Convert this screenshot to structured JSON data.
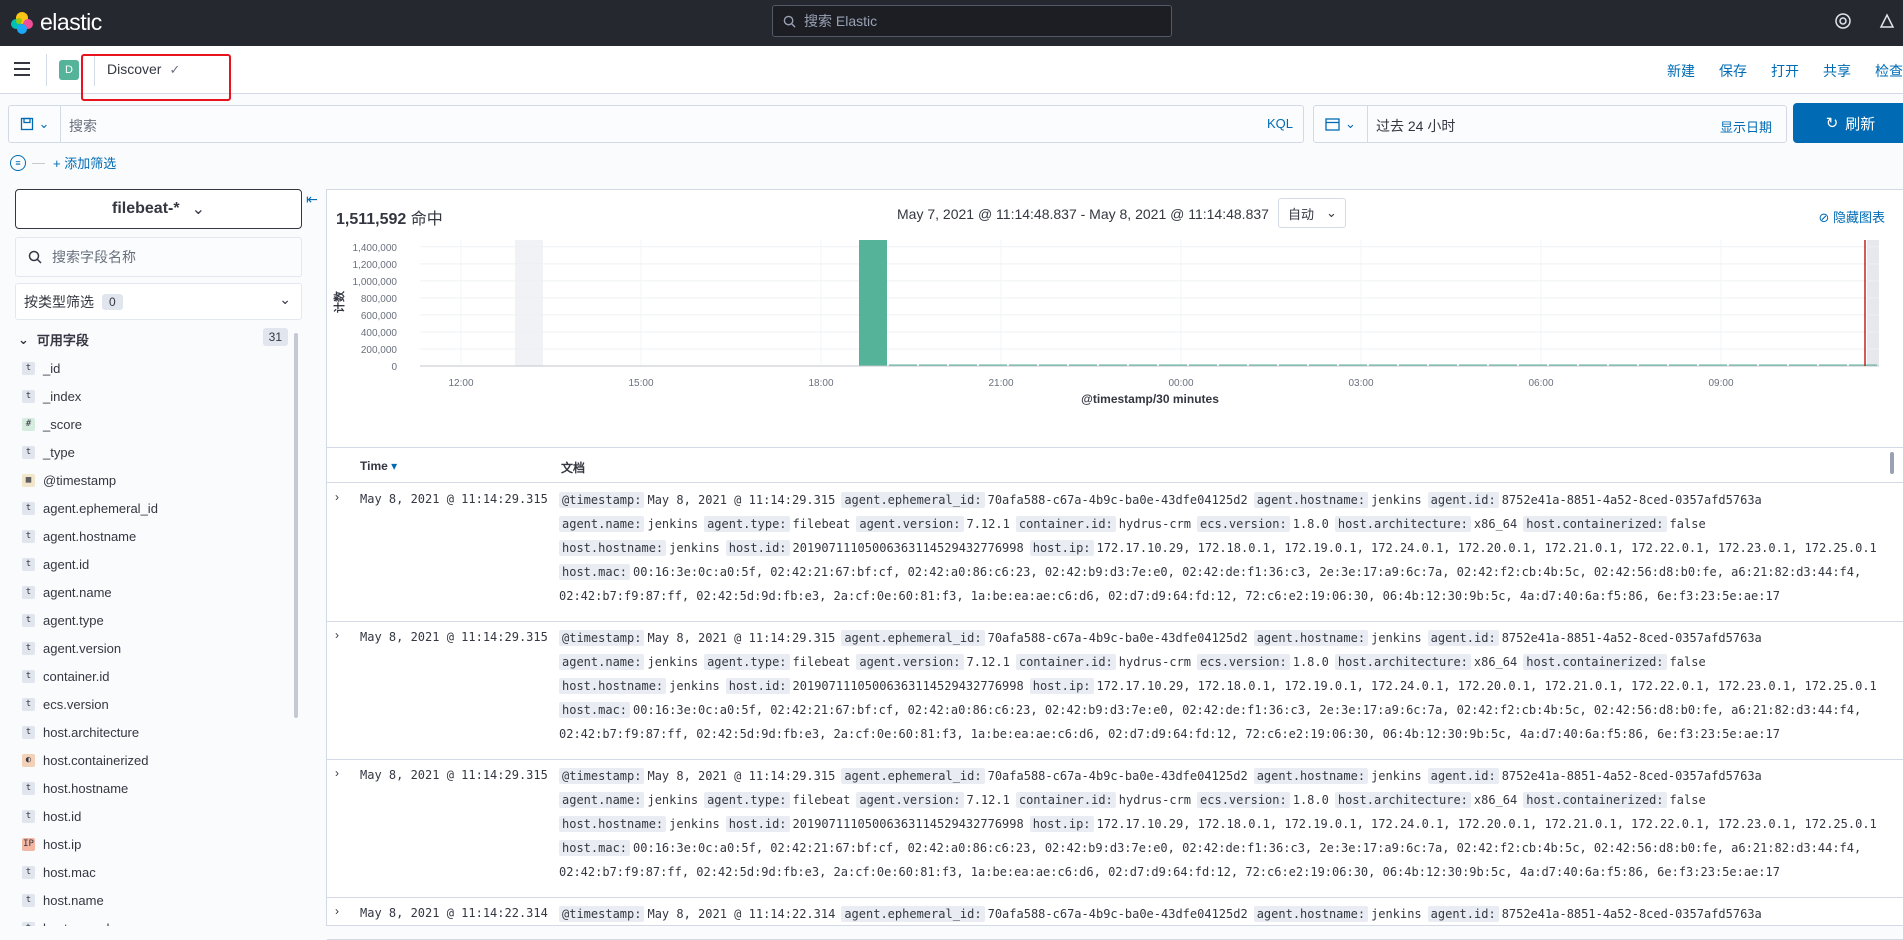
{
  "app": {
    "logo_text": "elastic",
    "global_search_placeholder": "搜索 Elastic"
  },
  "nav": {
    "space_initial": "D",
    "breadcrumb": "Discover",
    "actions": [
      "新建",
      "保存",
      "打开",
      "共享",
      "检查"
    ]
  },
  "query": {
    "placeholder": "搜索",
    "language": "KQL"
  },
  "time": {
    "range": "过去 24 小时",
    "show_dates": "显示日期",
    "refresh": "刷新"
  },
  "filters": {
    "add_filter": "+ 添加筛选"
  },
  "sidebar": {
    "index_pattern": "filebeat-*",
    "field_search_placeholder": "搜索字段名称",
    "type_filter_label": "按类型筛选",
    "type_filter_count": "0",
    "available_label": "可用字段",
    "available_count": "31",
    "fields": [
      {
        "type": "t",
        "name": "_id"
      },
      {
        "type": "t",
        "name": "_index"
      },
      {
        "type": "#",
        "name": "_score"
      },
      {
        "type": "t",
        "name": "_type"
      },
      {
        "type": "date",
        "name": "@timestamp"
      },
      {
        "type": "t",
        "name": "agent.ephemeral_id"
      },
      {
        "type": "t",
        "name": "agent.hostname"
      },
      {
        "type": "t",
        "name": "agent.id"
      },
      {
        "type": "t",
        "name": "agent.name"
      },
      {
        "type": "t",
        "name": "agent.type"
      },
      {
        "type": "t",
        "name": "agent.version"
      },
      {
        "type": "t",
        "name": "container.id"
      },
      {
        "type": "t",
        "name": "ecs.version"
      },
      {
        "type": "t",
        "name": "host.architecture"
      },
      {
        "type": "bool",
        "name": "host.containerized"
      },
      {
        "type": "t",
        "name": "host.hostname"
      },
      {
        "type": "t",
        "name": "host.id"
      },
      {
        "type": "ip",
        "name": "host.ip"
      },
      {
        "type": "t",
        "name": "host.mac"
      },
      {
        "type": "t",
        "name": "host.name"
      },
      {
        "type": "t",
        "name": "host.os.codename"
      }
    ]
  },
  "results": {
    "hits": "1,511,592",
    "hits_suffix": "命中",
    "date_range": "May 7, 2021 @ 11:14:48.837 - May 8, 2021 @ 11:14:48.837",
    "interval": "自动",
    "hide_chart": "隐藏图表",
    "col_time": "Time",
    "col_doc": "文档"
  },
  "chart_data": {
    "type": "bar",
    "ylabel": "计数",
    "xlabel": "@timestamp/30 minutes",
    "y_ticks": [
      "1,400,000",
      "1,200,000",
      "1,000,000",
      "800,000",
      "600,000",
      "400,000",
      "200,000",
      "0"
    ],
    "x_ticks": [
      "12:00",
      "15:00",
      "18:00",
      "21:00",
      "00:00",
      "03:00",
      "06:00",
      "09:00"
    ],
    "ylim": [
      0,
      1480000
    ],
    "series": [
      {
        "values": [
          1480000,
          5000,
          5000,
          5000,
          5000,
          5000,
          5000,
          5000,
          5000,
          5000,
          5000,
          5000,
          5000,
          5000,
          5000,
          5000,
          5000,
          5000,
          5000,
          5000,
          5000,
          5000,
          5000,
          5000,
          5000,
          5000,
          5000,
          5000,
          5000,
          5000,
          5000,
          5000,
          5000,
          5000
        ]
      }
    ],
    "colors": {
      "bar": "#54b399",
      "now_marker": "#bd271e"
    }
  },
  "rows": [
    {
      "time": "May 8, 2021 @ 11:14:29.315",
      "lines": [
        [
          [
            "@timestamp:",
            "May 8, 2021 @ 11:14:29.315"
          ],
          [
            "agent.ephemeral_id:",
            "70afa588-c67a-4b9c-ba0e-43dfe04125d2"
          ],
          [
            "agent.hostname:",
            "jenkins"
          ],
          [
            "agent.id:",
            "8752e41a-8851-4a52-8ced-0357afd5763a"
          ]
        ],
        [
          [
            "agent.name:",
            "jenkins"
          ],
          [
            "agent.type:",
            "filebeat"
          ],
          [
            "agent.version:",
            "7.12.1"
          ],
          [
            "container.id:",
            "hydrus-crm"
          ],
          [
            "ecs.version:",
            "1.8.0"
          ],
          [
            "host.architecture:",
            "x86_64"
          ],
          [
            "host.containerized:",
            "false"
          ]
        ],
        [
          [
            "host.hostname:",
            "jenkins"
          ],
          [
            "host.id:",
            "20190711105006363114529432776998"
          ],
          [
            "host.ip:",
            "172.17.10.29, 172.18.0.1, 172.19.0.1, 172.24.0.1, 172.20.0.1, 172.21.0.1, 172.22.0.1, 172.23.0.1, 172.25.0.1"
          ]
        ],
        [
          [
            "host.mac:",
            "00:16:3e:0c:a0:5f, 02:42:21:67:bf:cf, 02:42:a0:86:c6:23, 02:42:b9:d3:7e:e0, 02:42:de:f1:36:c3, 2e:3e:17:a9:6c:7a, 02:42:f2:cb:4b:5c, 02:42:56:d8:b0:fe, a6:21:82:d3:44:f4,"
          ]
        ],
        [
          [
            "",
            "02:42:b7:f9:87:ff, 02:42:5d:9d:fb:e3, 2a:cf:0e:60:81:f3, 1a:be:ea:ae:c6:d6, 02:d7:d9:64:fd:12, 72:c6:e2:19:06:30, 06:4b:12:30:9b:5c, 4a:d7:40:6a:f5:86, 6e:f3:23:5e:ae:17"
          ]
        ]
      ]
    },
    {
      "time": "May 8, 2021 @ 11:14:29.315",
      "lines": [
        [
          [
            "@timestamp:",
            "May 8, 2021 @ 11:14:29.315"
          ],
          [
            "agent.ephemeral_id:",
            "70afa588-c67a-4b9c-ba0e-43dfe04125d2"
          ],
          [
            "agent.hostname:",
            "jenkins"
          ],
          [
            "agent.id:",
            "8752e41a-8851-4a52-8ced-0357afd5763a"
          ]
        ],
        [
          [
            "agent.name:",
            "jenkins"
          ],
          [
            "agent.type:",
            "filebeat"
          ],
          [
            "agent.version:",
            "7.12.1"
          ],
          [
            "container.id:",
            "hydrus-crm"
          ],
          [
            "ecs.version:",
            "1.8.0"
          ],
          [
            "host.architecture:",
            "x86_64"
          ],
          [
            "host.containerized:",
            "false"
          ]
        ],
        [
          [
            "host.hostname:",
            "jenkins"
          ],
          [
            "host.id:",
            "20190711105006363114529432776998"
          ],
          [
            "host.ip:",
            "172.17.10.29, 172.18.0.1, 172.19.0.1, 172.24.0.1, 172.20.0.1, 172.21.0.1, 172.22.0.1, 172.23.0.1, 172.25.0.1"
          ]
        ],
        [
          [
            "host.mac:",
            "00:16:3e:0c:a0:5f, 02:42:21:67:bf:cf, 02:42:a0:86:c6:23, 02:42:b9:d3:7e:e0, 02:42:de:f1:36:c3, 2e:3e:17:a9:6c:7a, 02:42:f2:cb:4b:5c, 02:42:56:d8:b0:fe, a6:21:82:d3:44:f4,"
          ]
        ],
        [
          [
            "",
            "02:42:b7:f9:87:ff, 02:42:5d:9d:fb:e3, 2a:cf:0e:60:81:f3, 1a:be:ea:ae:c6:d6, 02:d7:d9:64:fd:12, 72:c6:e2:19:06:30, 06:4b:12:30:9b:5c, 4a:d7:40:6a:f5:86, 6e:f3:23:5e:ae:17"
          ]
        ]
      ]
    },
    {
      "time": "May 8, 2021 @ 11:14:29.315",
      "lines": [
        [
          [
            "@timestamp:",
            "May 8, 2021 @ 11:14:29.315"
          ],
          [
            "agent.ephemeral_id:",
            "70afa588-c67a-4b9c-ba0e-43dfe04125d2"
          ],
          [
            "agent.hostname:",
            "jenkins"
          ],
          [
            "agent.id:",
            "8752e41a-8851-4a52-8ced-0357afd5763a"
          ]
        ],
        [
          [
            "agent.name:",
            "jenkins"
          ],
          [
            "agent.type:",
            "filebeat"
          ],
          [
            "agent.version:",
            "7.12.1"
          ],
          [
            "container.id:",
            "hydrus-crm"
          ],
          [
            "ecs.version:",
            "1.8.0"
          ],
          [
            "host.architecture:",
            "x86_64"
          ],
          [
            "host.containerized:",
            "false"
          ]
        ],
        [
          [
            "host.hostname:",
            "jenkins"
          ],
          [
            "host.id:",
            "20190711105006363114529432776998"
          ],
          [
            "host.ip:",
            "172.17.10.29, 172.18.0.1, 172.19.0.1, 172.24.0.1, 172.20.0.1, 172.21.0.1, 172.22.0.1, 172.23.0.1, 172.25.0.1"
          ]
        ],
        [
          [
            "host.mac:",
            "00:16:3e:0c:a0:5f, 02:42:21:67:bf:cf, 02:42:a0:86:c6:23, 02:42:b9:d3:7e:e0, 02:42:de:f1:36:c3, 2e:3e:17:a9:6c:7a, 02:42:f2:cb:4b:5c, 02:42:56:d8:b0:fe, a6:21:82:d3:44:f4,"
          ]
        ],
        [
          [
            "",
            "02:42:b7:f9:87:ff, 02:42:5d:9d:fb:e3, 2a:cf:0e:60:81:f3, 1a:be:ea:ae:c6:d6, 02:d7:d9:64:fd:12, 72:c6:e2:19:06:30, 06:4b:12:30:9b:5c, 4a:d7:40:6a:f5:86, 6e:f3:23:5e:ae:17"
          ]
        ]
      ]
    },
    {
      "time": "May 8, 2021 @ 11:14:22.314",
      "lines": [
        [
          [
            "@timestamp:",
            "May 8, 2021 @ 11:14:22.314"
          ],
          [
            "agent.ephemeral_id:",
            "70afa588-c67a-4b9c-ba0e-43dfe04125d2"
          ],
          [
            "agent.hostname:",
            "jenkins"
          ],
          [
            "agent.id:",
            "8752e41a-8851-4a52-8ced-0357afd5763a"
          ]
        ]
      ]
    }
  ]
}
